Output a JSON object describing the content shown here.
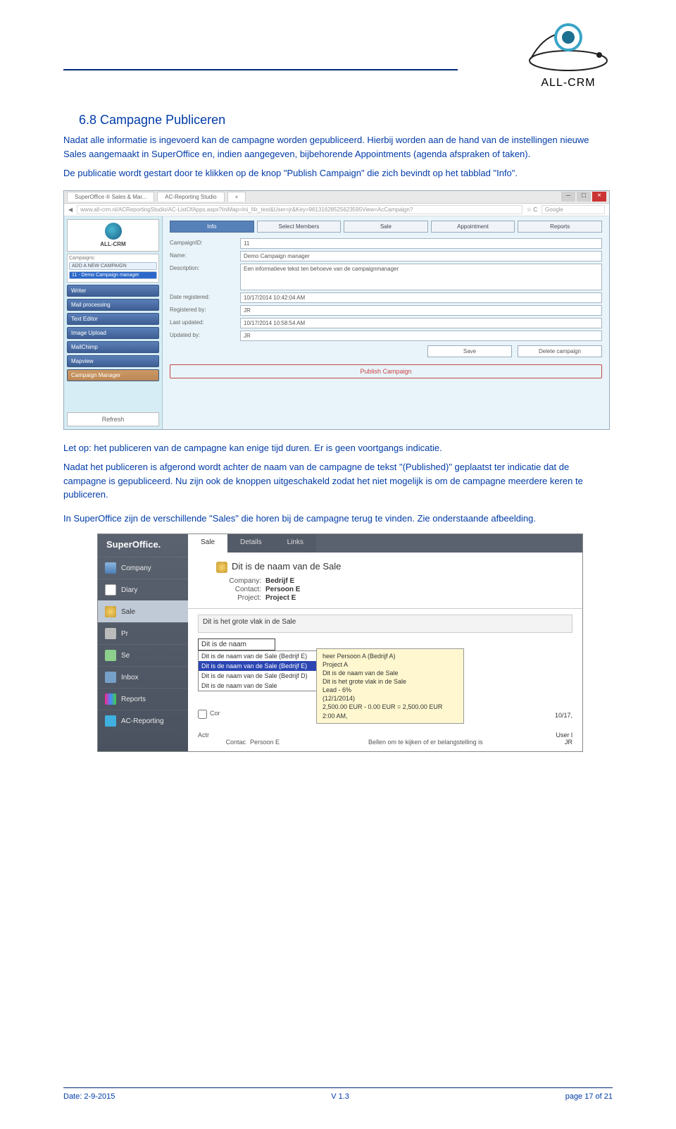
{
  "header": {
    "logo_text": "ALL-CRM"
  },
  "doc": {
    "section_title": "6.8 Campagne Publiceren",
    "p1": "Nadat alle informatie is ingevoerd kan de campagne worden gepubliceerd. Hierbij worden aan de hand van de instellingen nieuwe Sales aangemaakt in SuperOffice en, indien aangegeven, bijbehorende Appointments (agenda afspraken of taken).",
    "p2": "De publicatie wordt gestart door te klikken op de knop \"Publish Campaign\" die zich bevindt op het tabblad \"Info\".",
    "p3": "Let op: het publiceren van de campagne kan enige tijd duren. Er is geen voortgangs indicatie.",
    "p4": "Nadat het publiceren is afgerond wordt achter de naam van de campagne de tekst \"(Published)\" geplaatst ter indicatie dat de campagne is gepubliceerd. Nu zijn ook de knoppen uitgeschakeld zodat het niet mogelijk is om de campagne meerdere keren te publiceren.",
    "p5": "In SuperOffice zijn de verschillende \"Sales\" die horen bij de campagne terug te vinden. Zie onderstaande afbeelding."
  },
  "shot1": {
    "tab1": "SuperOffice ® Sales & Mar...",
    "tab2": "AC-Reporting Studio",
    "url": "www.all-crm.nl/ACReportingStudio/AC-ListOfApps.aspx?IniMap=Ini_f4r_test&User=jr&Key=96131628525623595View=AcCampaign?",
    "search_placeholder": "Google",
    "logo_text": "ALL-CRM",
    "campaigns_label": "Campaigns:",
    "campaigns_add": "ADD A NEW CAMPAIGN",
    "campaigns_item": "11 - Demo Campaign manager",
    "side": {
      "writer": "Writer",
      "mail": "Mail processing",
      "textedit": "Text Editor",
      "image": "Image Upload",
      "mailchimp": "MailChimp",
      "mapview": "Mapview",
      "campaign": "Campaign Manager"
    },
    "refresh": "Refresh",
    "tabs": {
      "info": "Info",
      "select": "Select Members",
      "sale": "Sale",
      "appt": "Appointment",
      "reports": "Reports"
    },
    "form": {
      "id_label": "CampaignID:",
      "id_value": "11",
      "name_label": "Name:",
      "name_value": "Demo Campaign manager",
      "desc_label": "Description:",
      "desc_value": "Een informatieve tekst ten behoeve van de campaignmanager",
      "datereg_label": "Date registered:",
      "datereg_value": "10/17/2014 10:42:04 AM",
      "regby_label": "Registered by:",
      "regby_value": "JR",
      "lastupd_label": "Last updated:",
      "lastupd_value": "10/17/2014 10:58:54 AM",
      "updby_label": "Updated by:",
      "updby_value": "JR"
    },
    "save": "Save",
    "delete": "Delete campaign",
    "publish": "Publish Campaign"
  },
  "shot2": {
    "brand": "SuperOffice.",
    "nav": {
      "company": "Company",
      "diary": "Diary",
      "sale": "Sale",
      "project": "Pr",
      "selection": "Se",
      "inbox": "Inbox",
      "reports": "Reports",
      "acr": "AC-Reporting"
    },
    "tabs": {
      "sale": "Sale",
      "details": "Details",
      "links": "Links"
    },
    "sale": {
      "name": "Dit is de naam van de Sale",
      "company_label": "Company:",
      "company_value": "Bedrijf E",
      "contact_label": "Contact:",
      "contact_value": "Persoon E",
      "project_label": "Project:",
      "project_value": "Project E"
    },
    "desc": "Dit is het grote vlak in de Sale",
    "editline": "Dit is de naam",
    "list": {
      "r1": "Dit is de naam van de Sale (Bedrijf E)",
      "r2": "Dit is de naam van de Sale (Bedrijf E)",
      "r3": "Dit is de naam van de Sale (Bedrijf D)",
      "r4": "Dit is de naam van de Sale"
    },
    "tooltip": {
      "l1": "heer Persoon A (Bedrijf A)",
      "l2": "Project A",
      "l3": "Dit is de naam van de Sale",
      "l4": "Dit is het grote vlak in de Sale",
      "l5": "Lead - 6%",
      "l6": "(12/1/2014)",
      "l7": "2,500.00 EUR - 0.00 EUR = 2,500.00 EUR",
      "l8": "2:00 AM,"
    },
    "bottom": {
      "cor": "Cor",
      "actr": "Actr",
      "contact_label": "Contac",
      "contact_value": "Persoon E",
      "task": "Bellen om te kijken of er belangstelling is",
      "date": "10/17,",
      "user_top": "User l",
      "user_bot": "JR"
    }
  },
  "footer": {
    "date": "Date: 2-9-2015",
    "version": "V 1.3",
    "page": "page 17 of 21"
  }
}
